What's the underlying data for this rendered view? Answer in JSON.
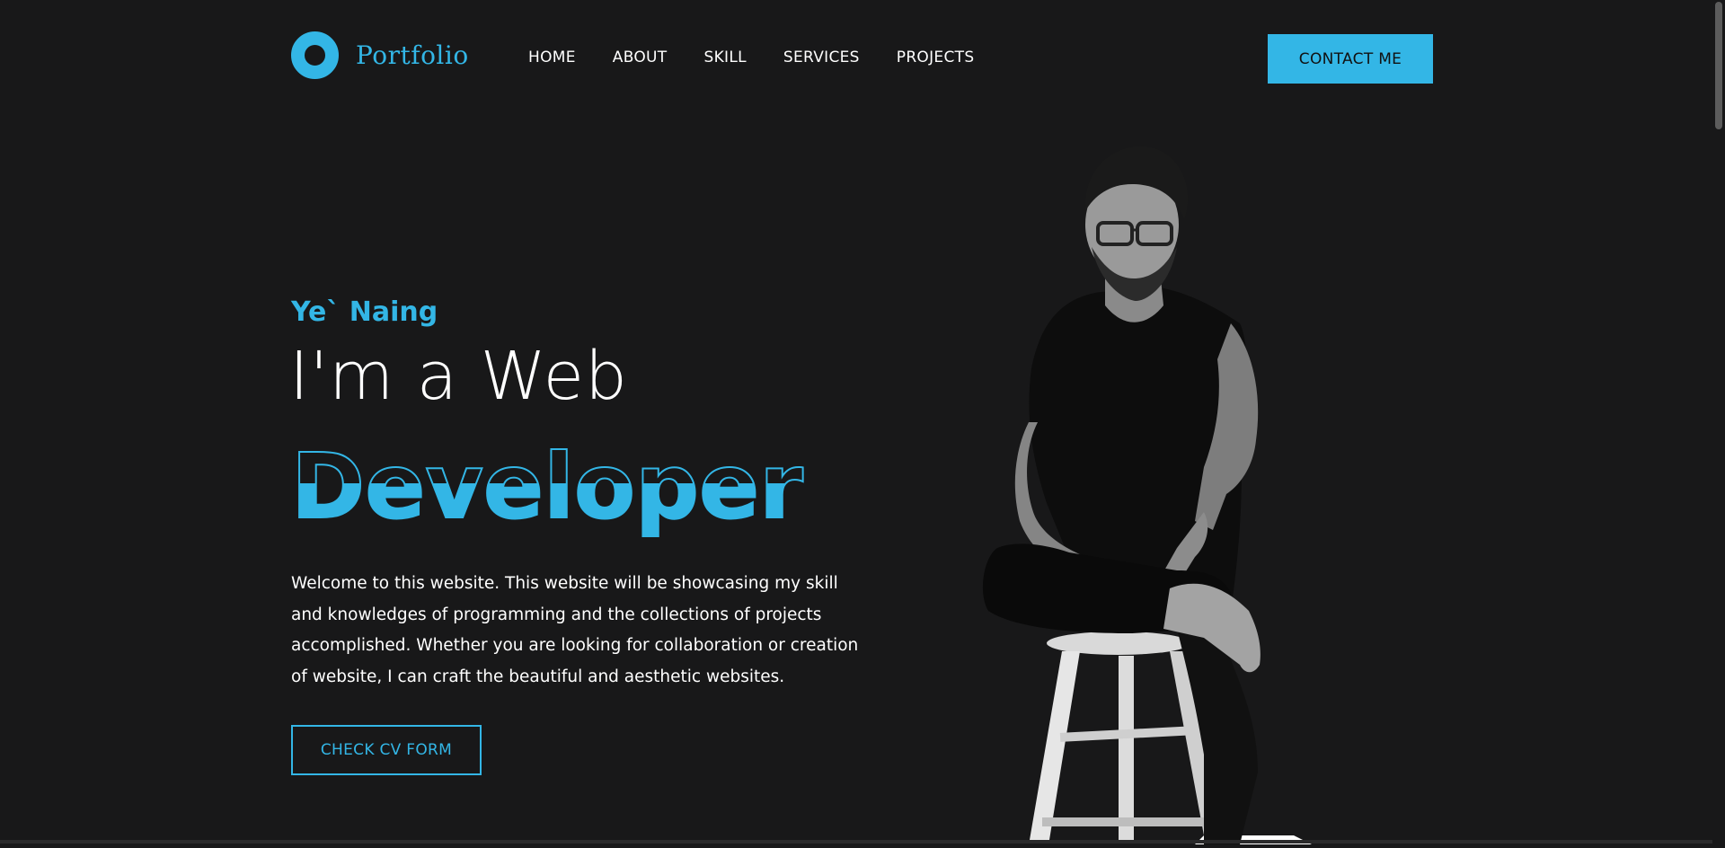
{
  "brand": {
    "text": "Portfolio",
    "accent": "#33b6e6",
    "icon": "ring-logo-icon"
  },
  "nav": {
    "items": [
      "HOME",
      "ABOUT",
      "SKILL",
      "SERVICES",
      "PROJECTS"
    ],
    "contact_label": "CONTACT ME"
  },
  "hero": {
    "name": "Ye` Naing",
    "headline": "I'm a Web",
    "role": "Developer",
    "intro": "Welcome to this website. This website will be showcasing my skill and knowledges of programming and the collections of projects accomplished. Whether you are looking for collaboration or creation of website, I can craft the beautiful and aesthetic websites.",
    "cv_label": "CHECK CV FORM"
  },
  "colors": {
    "background": "#181819",
    "accent": "#33b6e6",
    "text": "#ffffff"
  }
}
